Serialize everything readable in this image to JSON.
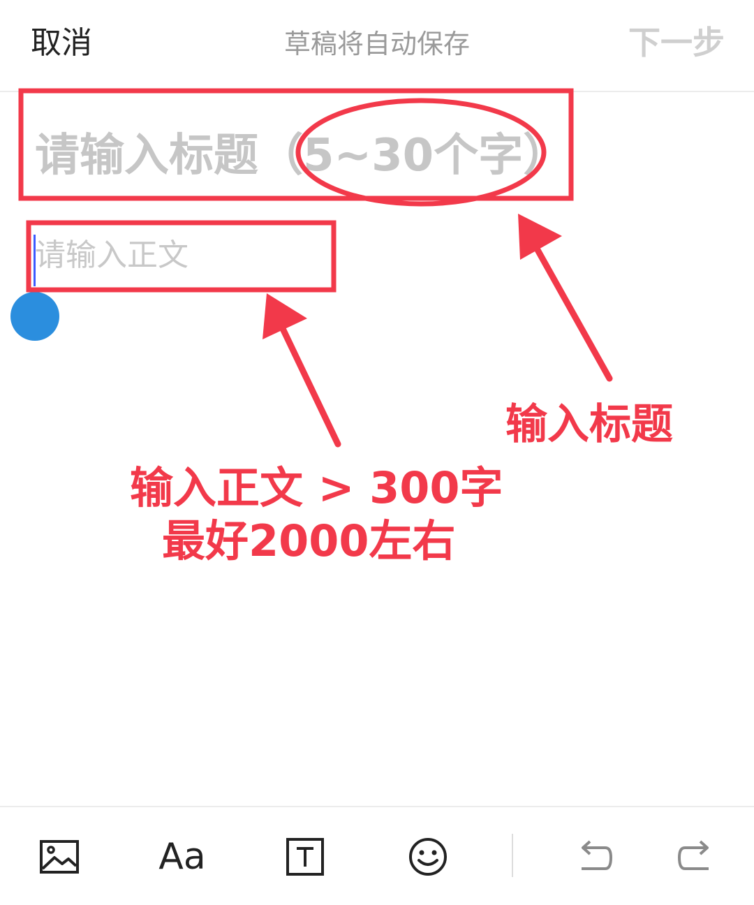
{
  "header": {
    "cancel_label": "取消",
    "status_text": "草稿将自动保存",
    "next_label": "下一步"
  },
  "editor": {
    "title_placeholder": "请输入标题（5~30个字）",
    "body_placeholder": "请输入正文"
  },
  "annotations": {
    "title_hint": "输入标题",
    "body_hint_line1": "输入正文 > 300字",
    "body_hint_line2": "最好2000左右",
    "color": "#f2394a"
  },
  "toolbar": {
    "items": [
      {
        "name": "image-icon"
      },
      {
        "name": "font-style-icon",
        "label": "Aa"
      },
      {
        "name": "text-box-icon",
        "label": "T"
      },
      {
        "name": "emoji-icon"
      },
      {
        "name": "undo-icon"
      },
      {
        "name": "redo-icon"
      }
    ]
  },
  "colors": {
    "accent_handle": "#2b8ede",
    "caret": "#3c5aff",
    "placeholder": "#c6c6c6"
  }
}
